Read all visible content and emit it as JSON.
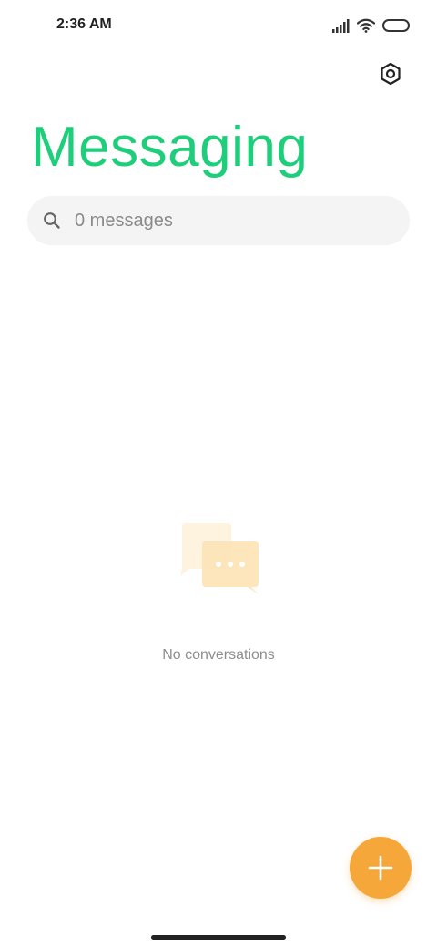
{
  "status_bar": {
    "time": "2:36 AM",
    "icons": [
      "signal-icon",
      "wifi-icon",
      "battery-icon"
    ]
  },
  "header": {
    "title": "Messaging",
    "settings_icon": "gear-icon"
  },
  "search": {
    "placeholder": "0 messages",
    "value": "",
    "icon": "search-icon"
  },
  "empty_state": {
    "message": "No conversations",
    "icon": "chat-bubbles-icon"
  },
  "fab": {
    "icon": "plus-icon"
  },
  "colors": {
    "title_green": "#1fce7b",
    "fab_orange": "#f5a73a",
    "search_bg": "#f4f4f4",
    "illustration_light": "#fdf3de",
    "illustration_main": "#fde4b8"
  }
}
